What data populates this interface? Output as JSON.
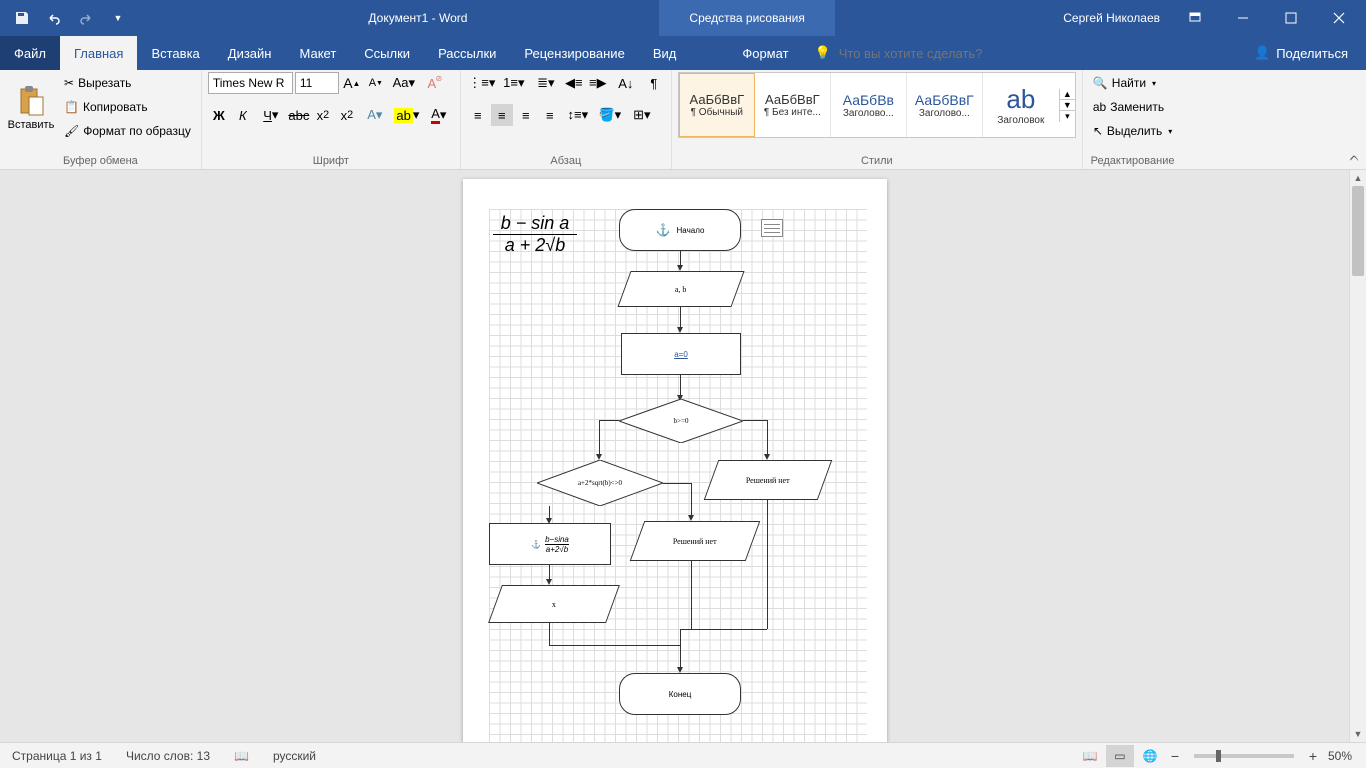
{
  "titlebar": {
    "doc_title": "Документ1 - Word",
    "context_tools": "Средства рисования",
    "user": "Сергей Николаев"
  },
  "tabs": {
    "file": "Файл",
    "home": "Главная",
    "insert": "Вставка",
    "design": "Дизайн",
    "layout": "Макет",
    "references": "Ссылки",
    "mailings": "Рассылки",
    "review": "Рецензирование",
    "view": "Вид",
    "format": "Формат",
    "tellme_placeholder": "Что вы хотите сделать?",
    "share": "Поделиться"
  },
  "ribbon": {
    "paste": "Вставить",
    "cut": "Вырезать",
    "copy": "Копировать",
    "format_painter": "Формат по образцу",
    "clipboard_group": "Буфер обмена",
    "font_name": "Times New R",
    "font_size": "11",
    "font_group": "Шрифт",
    "paragraph_group": "Абзац",
    "styles_group": "Стили",
    "editing_group": "Редактирование",
    "find": "Найти",
    "replace": "Заменить",
    "select": "Выделить",
    "styles": [
      {
        "preview": "АаБбВвГ",
        "label": "¶ Обычный"
      },
      {
        "preview": "АаБбВвГ",
        "label": "¶ Без инте..."
      },
      {
        "preview": "АаБбВв",
        "label": "Заголово..."
      },
      {
        "preview": "АаБбВвГ",
        "label": "Заголово..."
      },
      {
        "preview": "аb",
        "label": "Заголовок"
      }
    ]
  },
  "flowchart": {
    "start": "Начало",
    "input": "a, b",
    "process1": "a=0",
    "decision1": "b>=0",
    "decision2": "a+2*sqrt(b)<>0",
    "no_solution": "Решений нет",
    "no_solution2": "Решений нет",
    "output": "x",
    "end": "Конец",
    "formula_top": "b − sin a",
    "formula_bot": "a + 2√b",
    "formula_small_top": "b−sina",
    "formula_small_bot": "a+2√b"
  },
  "statusbar": {
    "page": "Страница 1 из 1",
    "words": "Число слов: 13",
    "language": "русский",
    "zoom": "50%"
  }
}
